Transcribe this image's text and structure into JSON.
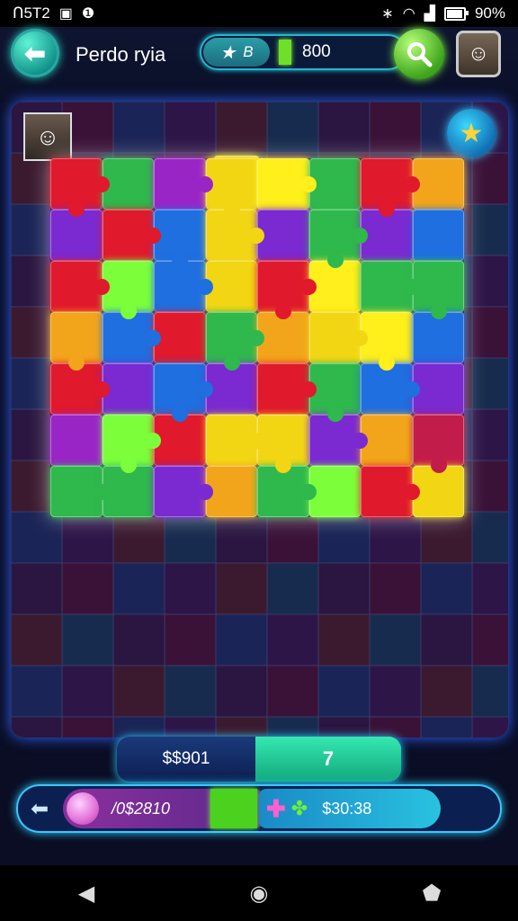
{
  "status_bar": {
    "left_text": "ᑎ5T2",
    "time_or_misc": "",
    "battery_text": "90%"
  },
  "header": {
    "title": "Perdo ryia",
    "stat_label": "B",
    "stat_value": "800"
  },
  "board": {
    "tile_colors": [
      [
        "#e0192c",
        "#2fb84c",
        "#9a25c7",
        "#f2d614",
        "#ffef1a",
        "#2fb84c",
        "#e0192c",
        "#f2a51b"
      ],
      [
        "#7a2ad0",
        "#e0192c",
        "#1f6fe0",
        "#f2d614",
        "#7a2ad0",
        "#2fb84c",
        "#7a2ad0",
        "#1f6fe0"
      ],
      [
        "#e0192c",
        "#7cff3a",
        "#1f6fe0",
        "#f2d614",
        "#e0192c",
        "#ffef1a",
        "#2fb84c",
        "#2fb84c"
      ],
      [
        "#f2a51b",
        "#1f6fe0",
        "#e0192c",
        "#2fb84c",
        "#f2a51b",
        "#f2d614",
        "#ffef1a",
        "#1f6fe0"
      ],
      [
        "#e0192c",
        "#7a2ad0",
        "#1f6fe0",
        "#7a2ad0",
        "#e0192c",
        "#2fb84c",
        "#1f6fe0",
        "#7a2ad0"
      ],
      [
        "#9a25c7",
        "#7cff3a",
        "#e0192c",
        "#f2d614",
        "#f2d614",
        "#7a2ad0",
        "#f2a51b",
        "#c21d4a"
      ],
      [
        "#2fb84c",
        "#2fb84c",
        "#7a2ad0",
        "#f2a51b",
        "#2fb84c",
        "#7cff3a",
        "#e0192c",
        "#f2d614"
      ]
    ],
    "top_tiles": [
      {
        "color": "#e0192c"
      },
      {
        "color": "#9a25c7"
      },
      {
        "color": "#e0192c"
      },
      {
        "color": "#f2d614"
      },
      {
        "color": "#e0192c"
      }
    ],
    "column_tiles": [
      {
        "color": "#f2d614"
      },
      {
        "color": "#f2d614"
      }
    ]
  },
  "score": {
    "left_value": "$$901",
    "right_value": "7"
  },
  "bottom_bar": {
    "coin_value": "/0$2810",
    "gem_value": "$30:38"
  },
  "icons": {
    "back": "arrow-left-icon",
    "search": "magnifier-icon",
    "star": "star-icon",
    "plus": "plus-icon",
    "clover": "clover-icon"
  }
}
